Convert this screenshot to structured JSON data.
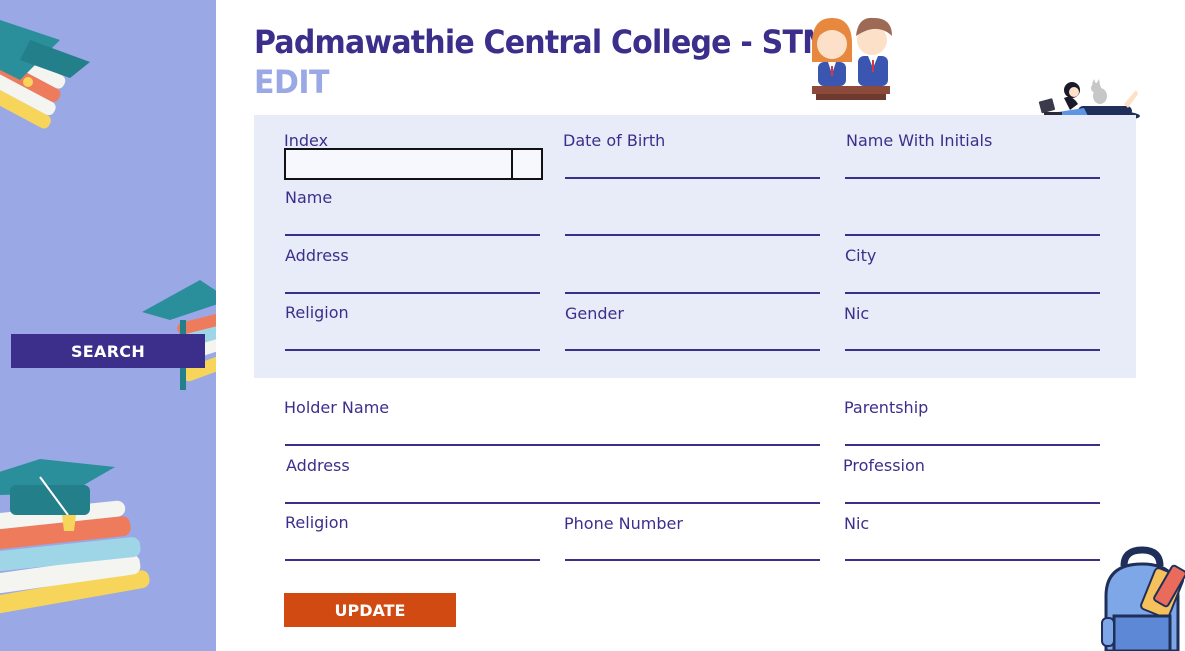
{
  "header": {
    "title": "Padmawathie Central College - STMS",
    "subtitle": "EDIT"
  },
  "sidebar": {
    "search_label": "SEARCH"
  },
  "student_form": {
    "index_label": "Index",
    "index_value": "",
    "dob_label": "Date of Birth",
    "name_initials_label": "Name With Initials",
    "name_label": "Name",
    "address_label": "Address",
    "city_label": "City",
    "religion_label": "Religion",
    "gender_label": "Gender",
    "nic_label": "Nic"
  },
  "guardian_form": {
    "holder_name_label": "Holder Name",
    "parentship_label": "Parentship",
    "address_label": "Address",
    "profession_label": "Profession",
    "religion_label": "Religion",
    "phone_label": "Phone Number",
    "nic_label": "Nic"
  },
  "actions": {
    "update_label": "UPDATE"
  },
  "colors": {
    "sidebar_bg": "#9aa8e6",
    "primary": "#3c2f8c",
    "panel_bg": "#e8ebf8",
    "update_bg": "#d04a12"
  }
}
